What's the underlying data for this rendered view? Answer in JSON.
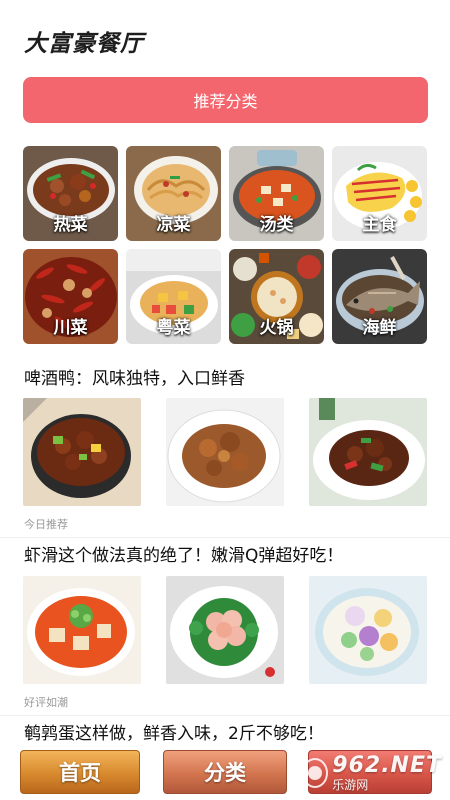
{
  "app": {
    "title": "大富豪餐厅"
  },
  "recommend_button": {
    "label": "推荐分类"
  },
  "categories": [
    {
      "label": "热菜",
      "icon": "hot-dish-photo"
    },
    {
      "label": "凉菜",
      "icon": "cold-dish-photo"
    },
    {
      "label": "汤类",
      "icon": "soup-photo"
    },
    {
      "label": "主食",
      "icon": "staple-food-photo"
    },
    {
      "label": "川菜",
      "icon": "sichuan-dish-photo"
    },
    {
      "label": "粤菜",
      "icon": "cantonese-dish-photo"
    },
    {
      "label": "火锅",
      "icon": "hotpot-photo"
    },
    {
      "label": "海鲜",
      "icon": "seafood-photo"
    }
  ],
  "articles": [
    {
      "title": "啤酒鸭：风味独特，入口鲜香",
      "tag": "今日推荐",
      "images": [
        "beer-duck-pot-photo",
        "beer-duck-plate-photo",
        "beer-duck-peppers-photo"
      ]
    },
    {
      "title": "虾滑这个做法真的绝了！嫩滑Q弹超好吃！",
      "tag": "好评如潮",
      "images": [
        "tofu-soup-photo",
        "shrimp-broccoli-photo",
        "dumpling-soup-photo"
      ]
    },
    {
      "title": "鹌鹑蛋这样做，鲜香入味，2斤不够吃！"
    }
  ],
  "bottom_nav": {
    "home_label": "首页",
    "category_label": "分类"
  },
  "watermark": {
    "brand": "962.NET",
    "sub": "乐游网"
  },
  "colors": {
    "accent": "#f4666e",
    "nav_home": "#d8892e",
    "nav_category": "#d2754f",
    "nav_third": "#d85649"
  }
}
